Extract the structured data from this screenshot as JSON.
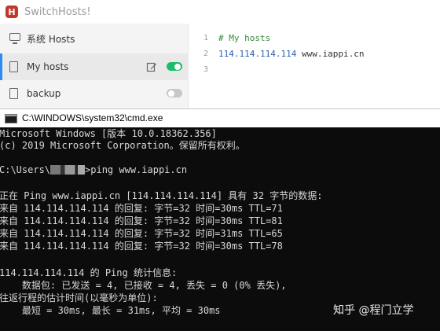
{
  "switchhosts": {
    "app_title": "SwitchHosts!",
    "logo_letter": "H",
    "sidebar": {
      "items": [
        {
          "label": "系统 Hosts",
          "icon": "monitor-icon",
          "active": false
        },
        {
          "label": "My hosts",
          "icon": "file-icon",
          "active": true,
          "enabled": true
        },
        {
          "label": "backup",
          "icon": "file-icon",
          "active": false,
          "enabled": false
        }
      ]
    },
    "editor": {
      "lines": [
        {
          "num": "1",
          "comment": "# My hosts"
        },
        {
          "num": "2",
          "ip": "114.114.114.114",
          "host": " www.iappi.cn"
        },
        {
          "num": "3"
        }
      ]
    }
  },
  "cmd": {
    "title": "C:\\WINDOWS\\system32\\cmd.exe",
    "lines": [
      "Microsoft Windows [版本 10.0.18362.356]",
      "(c) 2019 Microsoft Corporation。保留所有权利。",
      "",
      "C:\\Users\\",
      "",
      "正在 Ping www.iappi.cn [114.114.114.114] 具有 32 字节的数据:",
      "来自 114.114.114.114 的回复: 字节=32 时间=30ms TTL=71",
      "来自 114.114.114.114 的回复: 字节=32 时间=30ms TTL=81",
      "来自 114.114.114.114 的回复: 字节=32 时间=31ms TTL=65",
      "来自 114.114.114.114 的回复: 字节=32 时间=30ms TTL=78",
      "",
      "114.114.114.114 的 Ping 统计信息:",
      "    数据包: 已发送 = 4, 已接收 = 4, 丢失 = 0 (0% 丢失),",
      "往返行程的估计时间(以毫秒为单位):",
      "    最短 = 30ms, 最长 = 31ms, 平均 = 30ms"
    ],
    "prompt_command": ">ping www.iappi.cn"
  },
  "watermark": "知乎 @程门立学",
  "colors": {
    "toggle_on": "#19be6b",
    "toggle_off": "#c8c8c8",
    "active_indicator": "#2d8cf0",
    "comment": "#3a8a3a",
    "ip": "#2b5ea7",
    "console_bg": "#0c0c0c",
    "console_fg": "#d8d8d8"
  }
}
